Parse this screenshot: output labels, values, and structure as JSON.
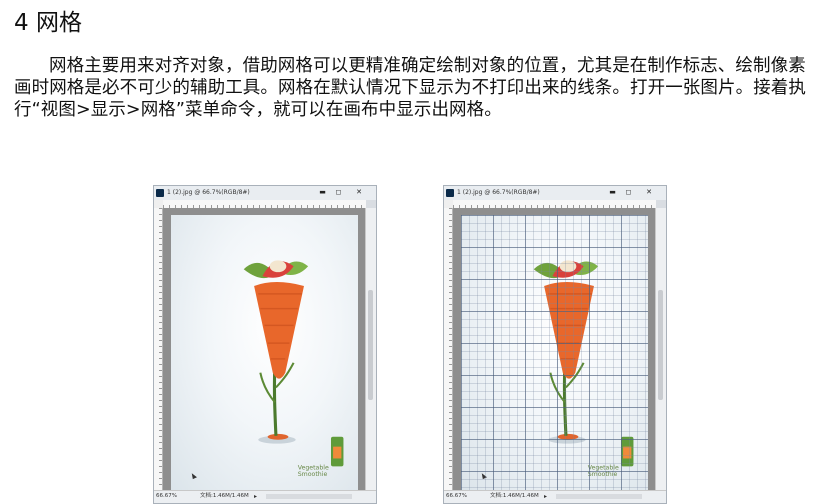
{
  "section": {
    "heading": "4 网格",
    "paragraph": "网格主要用来对齐对象，借助网格可以更精准确定绘制对象的位置，尤其是在制作标志、绘制像素画时网格是必不可少的辅助工具。网格在默认情况下显示为不打印出来的线条。打开一张图片。接着执行“视图>显示>网格”菜单命令，就可以在画布中显示出网格。"
  },
  "windows": [
    {
      "title": "1 (2).jpg @ 66.7%(RGB/8#)",
      "zoom": "66.67%",
      "doc_size": "文档:1.46M/1.46M",
      "grid_visible": false
    },
    {
      "title": "1 (2).jpg @ 66.7%(RGB/8#)",
      "zoom": "66.67%",
      "doc_size": "文档:1.46M/1.46M",
      "grid_visible": true
    }
  ],
  "window_buttons": {
    "minimize": "▬",
    "maximize": "◻",
    "close": "✕"
  },
  "icons": {
    "app": "photoshop-icon",
    "nav": "arrow-right-icon"
  }
}
